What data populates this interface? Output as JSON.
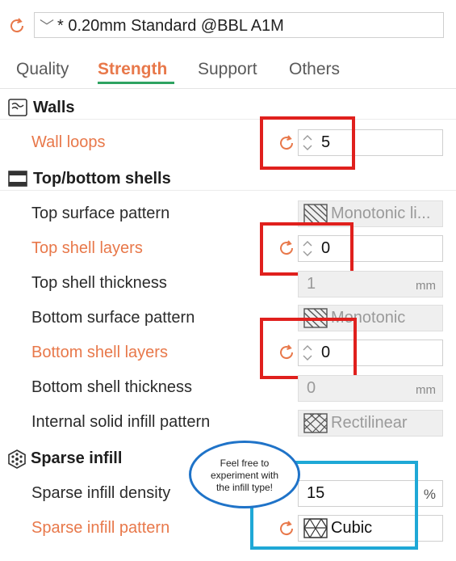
{
  "preset": {
    "name": "* 0.20mm Standard @BBL A1M"
  },
  "tabs": [
    {
      "label": "Quality"
    },
    {
      "label": "Strength"
    },
    {
      "label": "Support"
    },
    {
      "label": "Others"
    }
  ],
  "active_tab": "Strength",
  "sections": {
    "walls": {
      "title": "Walls"
    },
    "top_bottom": {
      "title": "Top/bottom shells"
    },
    "sparse": {
      "title": "Sparse infill"
    }
  },
  "settings": {
    "wall_loops": {
      "label": "Wall loops",
      "value": "5"
    },
    "top_surface_pattern": {
      "label": "Top surface pattern",
      "value": "Monotonic li..."
    },
    "top_shell_layers": {
      "label": "Top shell layers",
      "value": "0"
    },
    "top_shell_thickness": {
      "label": "Top shell thickness",
      "value": "1",
      "unit": "mm"
    },
    "bottom_surface_pattern": {
      "label": "Bottom surface pattern",
      "value": "Monotonic"
    },
    "bottom_shell_layers": {
      "label": "Bottom shell layers",
      "value": "0"
    },
    "bottom_shell_thickness": {
      "label": "Bottom shell thickness",
      "value": "0",
      "unit": "mm"
    },
    "internal_solid_infill_pattern": {
      "label": "Internal solid infill pattern",
      "value": "Rectilinear"
    },
    "sparse_infill_density": {
      "label": "Sparse infill density",
      "value": "15",
      "unit": "%"
    },
    "sparse_infill_pattern": {
      "label": "Sparse infill pattern",
      "value": "Cubic"
    }
  },
  "annotation": {
    "line1": "Feel free to",
    "line2": "experiment with",
    "line3": "the infill type!"
  },
  "colors": {
    "modified": "#e8784a",
    "active_tab_underline": "#2fa362",
    "red_highlight": "#e0201d",
    "blue_highlight": "#1fa8d6",
    "bubble_border": "#1f73c8"
  },
  "icons": [
    "undo-arrow-icon",
    "chevron-down-icon",
    "walls-icon",
    "shells-icon",
    "sparse-infill-icon",
    "spin-arrows-icon",
    "pattern-icon"
  ]
}
